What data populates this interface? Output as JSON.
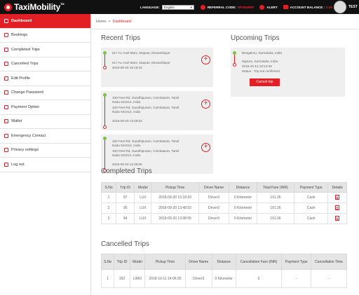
{
  "header": {
    "brand": "TaxiMobility",
    "brand_mark": "TM",
    "language_label": "LANGUAGE:",
    "language_value": "English",
    "referral_label": "REFERRAL CODE:",
    "referral_code": "RP0E58RP",
    "alert_label": "ALERT",
    "balance_label": "ACCOUNT BALANCE :",
    "balance_value": "0.00",
    "username": "TEST"
  },
  "sidebar": {
    "items": [
      {
        "label": "Dashboard"
      },
      {
        "label": "Bookings"
      },
      {
        "label": "Completed Trips"
      },
      {
        "label": "Cancelled Trips"
      },
      {
        "label": "Edit Profile"
      },
      {
        "label": "Change Password"
      },
      {
        "label": "Payment Option"
      },
      {
        "label": "Wallet"
      },
      {
        "label": "Emergency Contact"
      },
      {
        "label": "Privacy settings"
      },
      {
        "label": "Log out"
      }
    ]
  },
  "breadcrumb": {
    "home": "Home",
    "separator": ">",
    "current": "Dashboard"
  },
  "recent": {
    "title": "Recent Trips",
    "trips": [
      {
        "pickup": "617 Av. Karl Marx, Maputo, Mozambique",
        "drop": "617 Av. Karl Marx, Maputo, Mozambique",
        "time": "2018-09-20 15:18:33"
      },
      {
        "pickup": "100 Feet Rd, Gandhipuram, Coimbatore, Tamil Nadu 641012, India",
        "drop": "100 Feet Rd, Gandhipuram, Coimbatore, Tamil Nadu 641012, India",
        "time": "2018-09-20 13:48:53"
      },
      {
        "pickup": "100 Feet Rd, Gandhipuram, Coimbatore, Tamil Nadu 641012, India",
        "drop": "100 Feet Rd, Gandhipuram, Coimbatore, Tamil Nadu 641012, India",
        "time": "2018-09-20 13:38:55"
      }
    ]
  },
  "upcoming": {
    "title": "Upcoming Trips",
    "pickup": "Bengaluru, Karnataka, India",
    "drop": "Mysuru, Karnataka, India",
    "time": "2018-10-12 19:12:36",
    "status": "Status : Trip not confirmed",
    "cancel_label": "Cancel trip"
  },
  "completed": {
    "title": "Completed Trips",
    "headers": [
      "S.No",
      "Trip ID",
      "Model",
      "Pickup Time",
      "Driver Name",
      "Distance",
      "Total Fare (INR)",
      "Payment Type",
      "Details"
    ],
    "rows": [
      [
        "1",
        "97",
        "LUX",
        "2018-09-20 15:18:33",
        "Driver3",
        "0 Kilometer",
        "101.26",
        "Cash"
      ],
      [
        "2",
        "95",
        "LUX",
        "2018-09-20 13:48:53",
        "Driver3",
        "0 Kilometer",
        "101.26",
        "Cash"
      ],
      [
        "3",
        "94",
        "LUX",
        "2018-09-20 13:38:55",
        "Driver3",
        "0 Kilometer",
        "101.26",
        "Cash"
      ]
    ]
  },
  "cancelled": {
    "title": "Cancelled Trips",
    "headers": [
      "S.No",
      "Trip ID",
      "Model",
      "Pickup Time",
      "Driver Name",
      "Distance",
      "Cancellation Fare (INR)",
      "Payment Type",
      "Cancellation Time"
    ],
    "rows": [
      [
        "1",
        "152",
        "LIMO",
        "2018-10-11 14:06:35",
        "Driver3",
        "0 Kilometer",
        "0",
        "-",
        "-"
      ]
    ]
  }
}
